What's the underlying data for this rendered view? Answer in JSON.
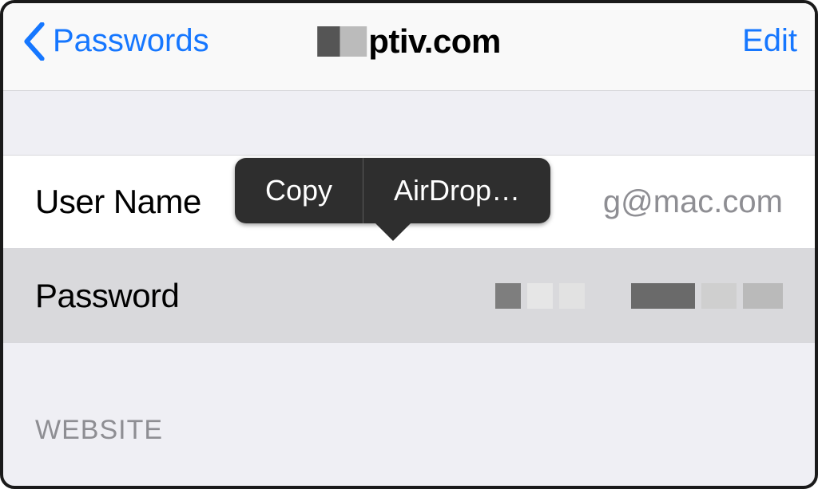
{
  "nav": {
    "back_label": "Passwords",
    "title_suffix": "ptiv.com",
    "edit_label": "Edit"
  },
  "credentials": {
    "username_label": "User Name",
    "username_value_suffix": "g@mac.com",
    "password_label": "Password"
  },
  "popover": {
    "copy_label": "Copy",
    "airdrop_label": "AirDrop…"
  },
  "section": {
    "website_header": "WEBSITE"
  }
}
